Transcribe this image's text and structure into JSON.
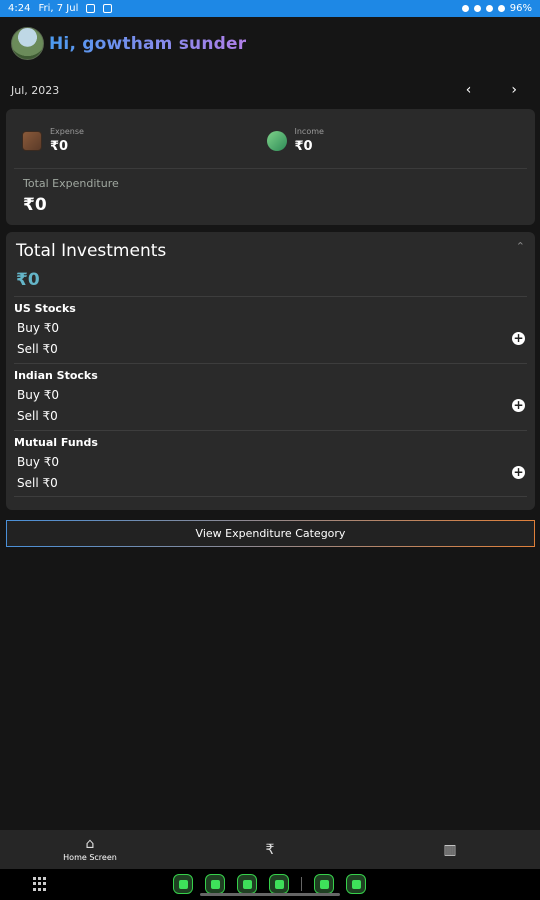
{
  "status_bar": {
    "time": "4:24",
    "date": "Fri, 7 Jul",
    "battery": "96%"
  },
  "header": {
    "greeting": "Hi, gowtham sunder"
  },
  "period": {
    "month_label": "Jul, 2023",
    "prev_icon": "chevron-left-icon",
    "next_icon": "chevron-right-icon"
  },
  "summary": {
    "expense_label": "Expense",
    "expense_value": "₹0",
    "income_label": "Income",
    "income_value": "₹0",
    "total_label": "Total Expenditure",
    "total_value": "₹0"
  },
  "investments": {
    "title": "Total Investments",
    "total": "₹0",
    "sections": [
      {
        "name": "US Stocks",
        "buy": "Buy  ₹0",
        "sell": "Sell  ₹0"
      },
      {
        "name": "Indian Stocks",
        "buy": "Buy  ₹0",
        "sell": "Sell  ₹0"
      },
      {
        "name": "Mutual Funds",
        "buy": "Buy  ₹0",
        "sell": "Sell  ₹0"
      }
    ]
  },
  "actions": {
    "view_category": "View Expenditure Category"
  },
  "bottom_nav": {
    "home_label": "Home Screen",
    "home_icon": "home-icon",
    "rupee_icon": "rupee-icon",
    "chart_icon": "bar-chart-icon"
  },
  "colors": {
    "status_bar": "#1e88e5",
    "background": "#151515",
    "card": "#2a2a2a",
    "accent_total": "#64b5c8"
  }
}
